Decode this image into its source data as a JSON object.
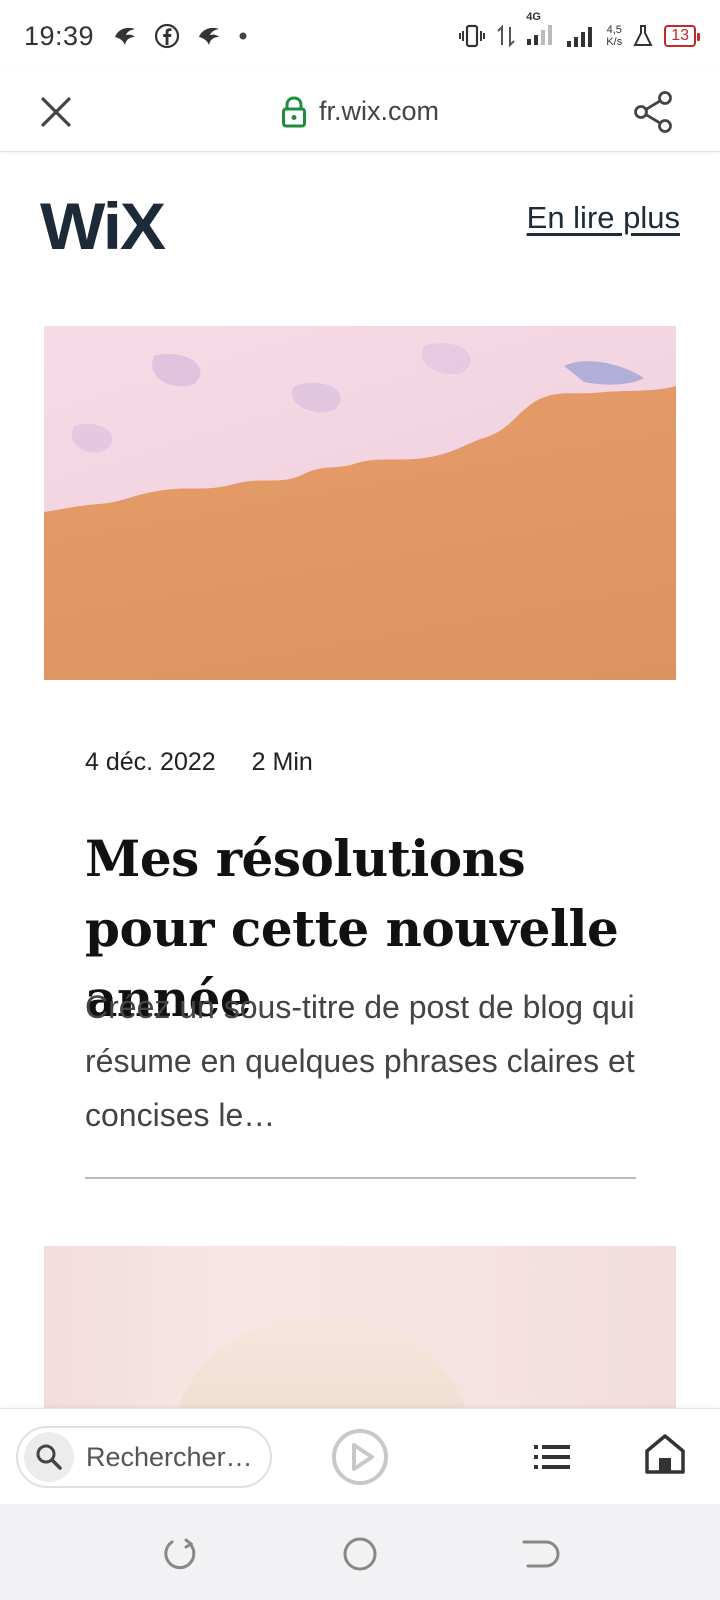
{
  "status_bar": {
    "time": "19:39",
    "network": "4G",
    "speed_value": "4,5",
    "speed_unit": "K/s",
    "battery": "13",
    "battery_color": "#c62828"
  },
  "browser": {
    "url": "fr.wix.com",
    "lock_color": "#1e8e3e"
  },
  "site": {
    "logo": "WiX",
    "read_more": "En lire plus"
  },
  "post": {
    "date": "4 déc. 2022",
    "read_time": "2 Min",
    "title": "Mes résolutions pour cette nouvelle année",
    "excerpt": "Créez un sous-titre de post de blog qui résume en quelques phrases claires et concises le…"
  },
  "bottom_toolbar": {
    "search_placeholder": "Rechercher…"
  },
  "icons": {
    "close": "close-icon",
    "lock": "lock-icon",
    "share": "share-icon",
    "search": "search-icon",
    "play": "play-icon",
    "list": "list-icon",
    "home": "home-icon"
  }
}
